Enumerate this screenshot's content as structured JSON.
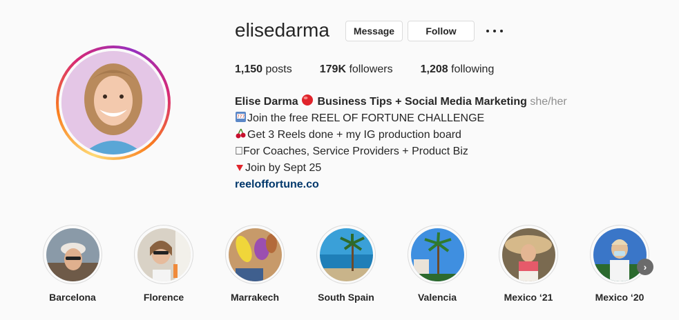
{
  "profile": {
    "username": "elisedarma",
    "message_label": "Message",
    "follow_label": "Follow",
    "more_icon": "more-horizontal-icon",
    "stats": [
      {
        "value": "1,150",
        "label": "posts"
      },
      {
        "value": "179K",
        "label": "followers"
      },
      {
        "value": "1,208",
        "label": "following"
      }
    ]
  },
  "bio": {
    "name": "Elise Darma",
    "headline": "Business Tips + Social Media Marketing",
    "pronouns": "she/her",
    "line1": "Join the free REEL OF FORTUNE CHALLENGE",
    "line2": "Get 3 Reels done + my IG production board",
    "line3": "For Coaches, Service Providers + Product Biz",
    "line4": "Join by Sept 25",
    "link": "reeloffortune.co"
  },
  "highlights": [
    {
      "label": "Barcelona"
    },
    {
      "label": "Florence"
    },
    {
      "label": "Marrakech"
    },
    {
      "label": "South Spain"
    },
    {
      "label": "Valencia"
    },
    {
      "label": "Mexico ‘21"
    },
    {
      "label": "Mexico ‘20"
    }
  ],
  "colors": {
    "text": "#262626",
    "muted": "#8e8e8e",
    "link": "#00376b",
    "border": "#dbdbdb",
    "background": "#fafafa"
  }
}
